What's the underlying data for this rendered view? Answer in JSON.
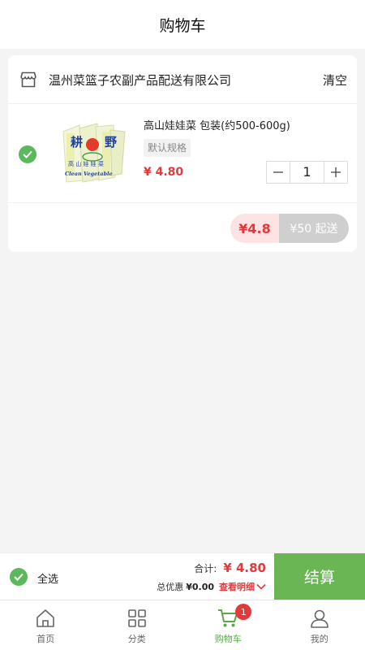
{
  "header": {
    "title": "购物车"
  },
  "store": {
    "name": "温州菜篮子农副产品配送有限公司",
    "clear_label": "清空"
  },
  "cart_item": {
    "name": "高山娃娃菜 包装(约500-600g)",
    "spec": "默认规格",
    "price": "¥ 4.80",
    "quantity": "1",
    "selected": true,
    "image_text": {
      "left": "耕",
      "right": "野",
      "line2": "高 山 娃 娃 菜",
      "line3": "Clean Vegetable"
    }
  },
  "store_summary": {
    "amount": "¥4.8",
    "min_order": "¥50 起送"
  },
  "footer": {
    "select_all_label": "全选",
    "total_label": "合计:",
    "total_value": "¥ 4.80",
    "discount_label": "总优惠",
    "discount_value": "¥0.00",
    "detail_label": "查看明细",
    "checkout_label": "结算"
  },
  "tabs": [
    {
      "label": "首页",
      "icon": "home-icon"
    },
    {
      "label": "分类",
      "icon": "category-grid-icon"
    },
    {
      "label": "购物车",
      "icon": "cart-icon",
      "badge": "1",
      "active": true
    },
    {
      "label": "我的",
      "icon": "user-icon"
    }
  ],
  "colors": {
    "accent_green": "#6ab655",
    "price_red": "#e4393c",
    "check_green": "#5cb85c"
  }
}
